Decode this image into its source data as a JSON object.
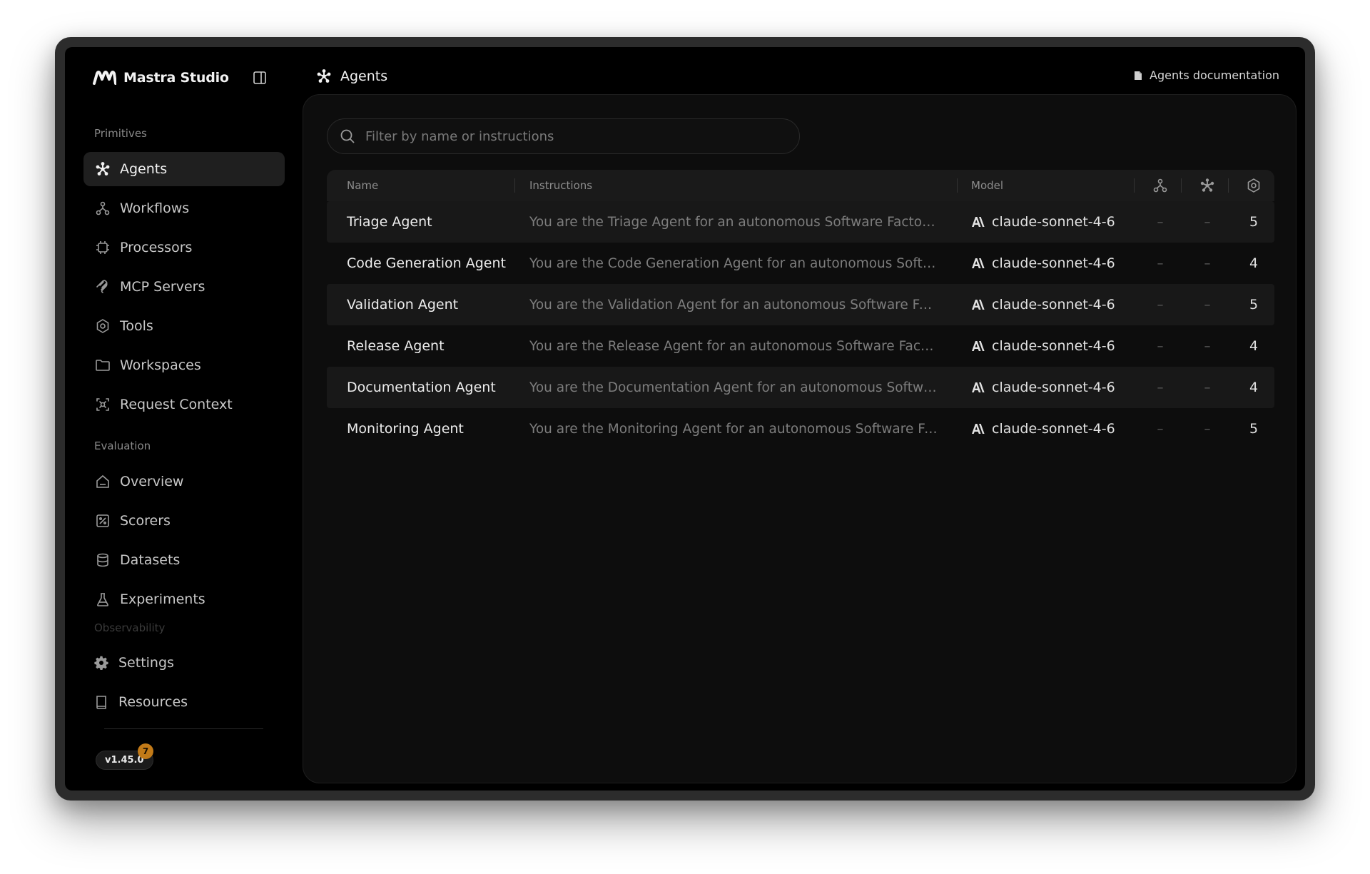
{
  "sidebar": {
    "brand": "Mastra Studio",
    "sections": {
      "primitives": "Primitives",
      "evaluation": "Evaluation",
      "observability": "Observability"
    },
    "primitives": [
      {
        "label": "Agents",
        "icon": "agents-icon",
        "active": true
      },
      {
        "label": "Workflows",
        "icon": "workflows-icon"
      },
      {
        "label": "Processors",
        "icon": "processors-icon"
      },
      {
        "label": "MCP Servers",
        "icon": "mcp-icon"
      },
      {
        "label": "Tools",
        "icon": "tools-icon"
      },
      {
        "label": "Workspaces",
        "icon": "folder-icon"
      },
      {
        "label": "Request Context",
        "icon": "request-context-icon"
      }
    ],
    "evaluation": [
      {
        "label": "Overview",
        "icon": "home-icon"
      },
      {
        "label": "Scorers",
        "icon": "scorers-icon"
      },
      {
        "label": "Datasets",
        "icon": "database-icon"
      },
      {
        "label": "Experiments",
        "icon": "flask-icon"
      }
    ],
    "footer": [
      {
        "label": "Settings",
        "icon": "gear-icon"
      },
      {
        "label": "Resources",
        "icon": "book-icon"
      }
    ],
    "version": "v1.45.0",
    "version_badge": "7"
  },
  "header": {
    "title": "Agents",
    "docs_link": "Agents documentation"
  },
  "search": {
    "placeholder": "Filter by name or instructions"
  },
  "table": {
    "columns": {
      "name": "Name",
      "instructions": "Instructions",
      "model": "Model"
    },
    "rows": [
      {
        "name": "Triage Agent",
        "instructions": "You are the Triage Agent for an autonomous Software Factory. ...",
        "model": "claude-sonnet-4-6",
        "workflows": "–",
        "agents": "–",
        "tools": "5"
      },
      {
        "name": "Code Generation Agent",
        "instructions": "You are the Code Generation Agent for an autonomous Softw...",
        "model": "claude-sonnet-4-6",
        "workflows": "–",
        "agents": "–",
        "tools": "4"
      },
      {
        "name": "Validation Agent",
        "instructions": "You are the Validation Agent for an autonomous Software Fac...",
        "model": "claude-sonnet-4-6",
        "workflows": "–",
        "agents": "–",
        "tools": "5"
      },
      {
        "name": "Release Agent",
        "instructions": "You are the Release Agent for an autonomous Software Factor...",
        "model": "claude-sonnet-4-6",
        "workflows": "–",
        "agents": "–",
        "tools": "4"
      },
      {
        "name": "Documentation Agent",
        "instructions": "You are the Documentation Agent for an autonomous Softwar...",
        "model": "claude-sonnet-4-6",
        "workflows": "–",
        "agents": "–",
        "tools": "4"
      },
      {
        "name": "Monitoring Agent",
        "instructions": "You are the Monitoring Agent for an autonomous Software Fac...",
        "model": "claude-sonnet-4-6",
        "workflows": "–",
        "agents": "–",
        "tools": "5"
      }
    ]
  },
  "colors": {
    "background": "#000000",
    "panel": "#0d0d0d",
    "row_shade": "#181818",
    "badge": "#c27a18"
  }
}
